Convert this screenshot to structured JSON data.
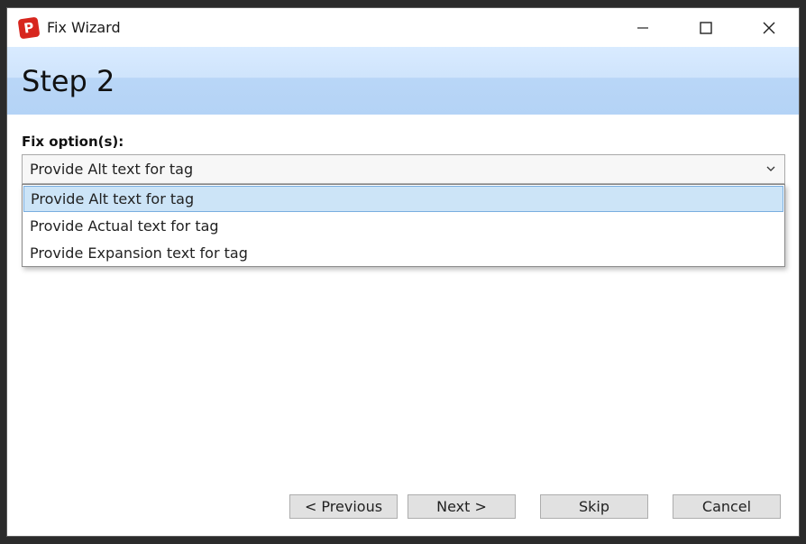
{
  "window": {
    "title": "Fix Wizard",
    "app_icon_letter": "P"
  },
  "header": {
    "step_title": "Step 2"
  },
  "fix_options": {
    "label": "Fix option(s):",
    "selected": "Provide Alt text for tag",
    "options": [
      "Provide Alt text for tag",
      "Provide Actual text for tag",
      "Provide Expansion text for tag"
    ]
  },
  "buttons": {
    "previous": "< Previous",
    "next": "Next >",
    "skip": "Skip",
    "cancel": "Cancel"
  },
  "icons": {
    "minimize": "minimize-icon",
    "maximize": "maximize-icon",
    "close": "close-icon",
    "dropdown": "chevron-down-icon"
  },
  "colors": {
    "header_band": "#c7e0fb",
    "selected_item": "#cce4f7",
    "button_face": "#e1e1e1",
    "app_icon": "#d7261e"
  }
}
